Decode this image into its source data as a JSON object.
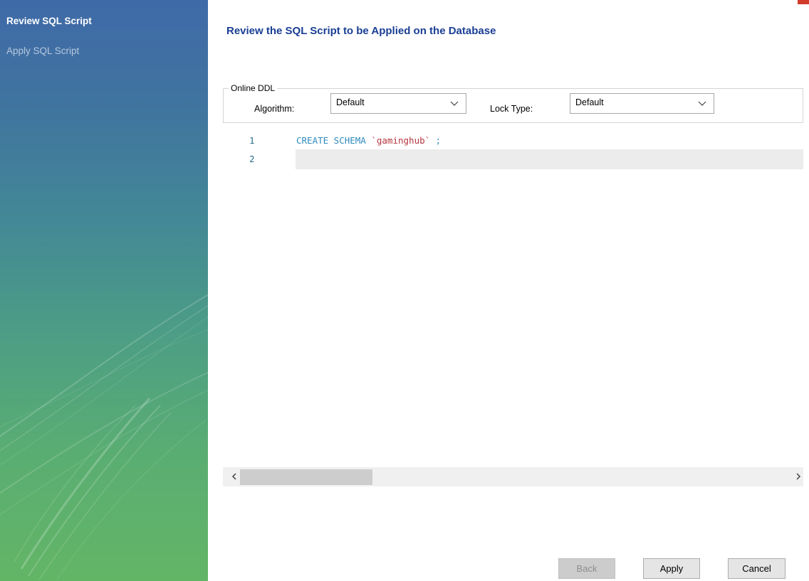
{
  "sidebar": {
    "steps": [
      {
        "label": "Review SQL Script",
        "active": true
      },
      {
        "label": "Apply SQL Script",
        "active": false
      }
    ]
  },
  "main": {
    "title": "Review the SQL Script to be Applied on the Database",
    "online_ddl": {
      "legend": "Online DDL",
      "algorithm_label": "Algorithm:",
      "algorithm_value": "Default",
      "lock_type_label": "Lock Type:",
      "lock_type_value": "Default"
    },
    "editor": {
      "lines": [
        {
          "number": "1",
          "keyword": "CREATE SCHEMA ",
          "identifier": "`gaminghub`",
          "terminator": " ;"
        },
        {
          "number": "2"
        }
      ]
    }
  },
  "buttons": {
    "back": "Back",
    "apply": "Apply",
    "cancel": "Cancel"
  },
  "colors": {
    "title": "#1a3e94",
    "keyword": "#2f8bbd",
    "identifier": "#b5363f",
    "sidebar_top": "#3f6aa8",
    "sidebar_bottom": "#63b566"
  }
}
